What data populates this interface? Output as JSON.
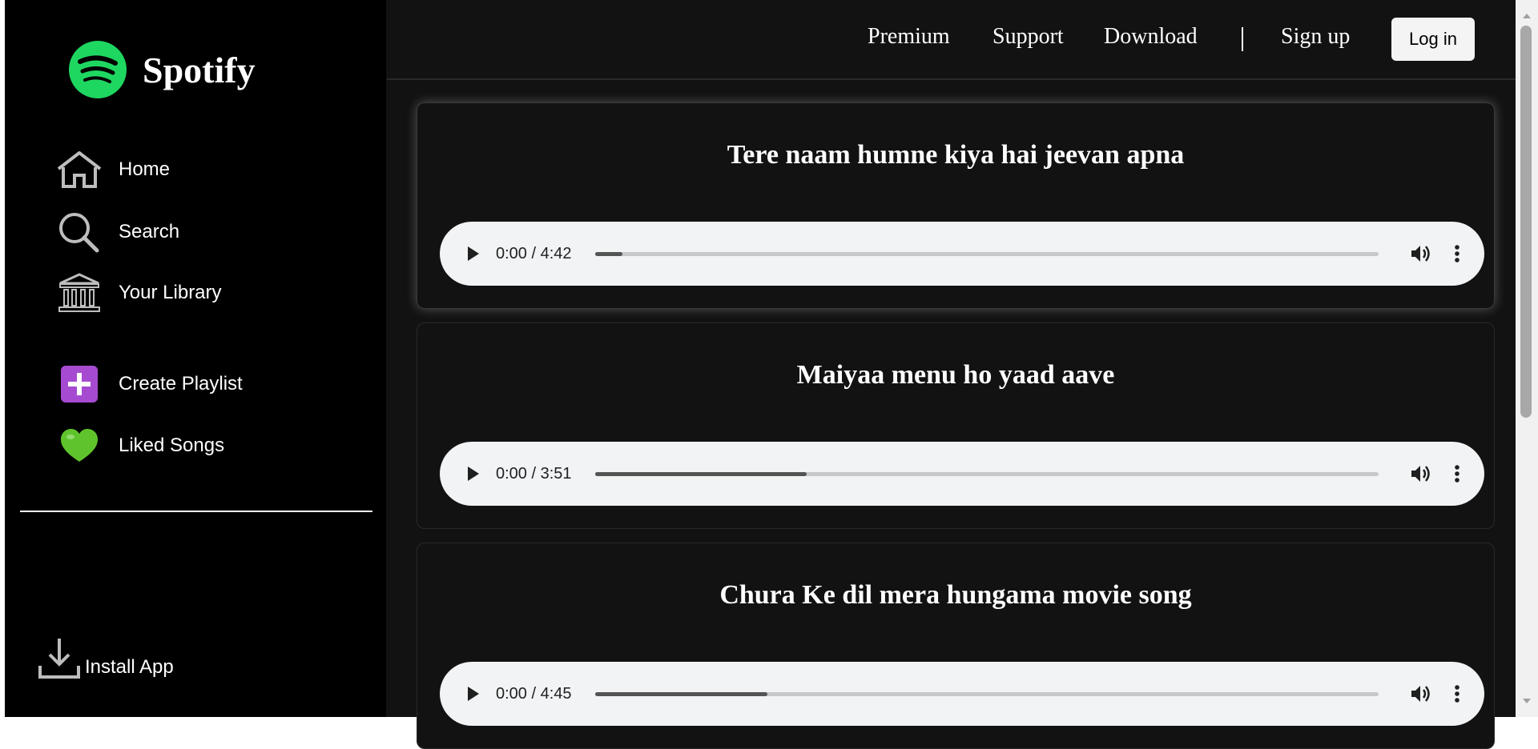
{
  "sidebar": {
    "brand": {
      "name": "Spotify",
      "logo_icon": "spotify-logo-icon",
      "logo_color": "#1ed760"
    },
    "nav": [
      {
        "label": "Home",
        "icon": "home-icon"
      },
      {
        "label": "Search",
        "icon": "search-icon"
      },
      {
        "label": "Your Library",
        "icon": "library-icon"
      }
    ],
    "actions": [
      {
        "label": "Create Playlist",
        "icon": "plus-icon",
        "color": "#a64bd1"
      },
      {
        "label": "Liked Songs",
        "icon": "green-heart-icon",
        "color": "#5fc42c"
      }
    ],
    "install": {
      "label": "Install App",
      "icon": "download-icon"
    }
  },
  "topbar": {
    "links": [
      "Premium",
      "Support",
      "Download"
    ],
    "separator": "|",
    "signup": "Sign up",
    "login": "Log in"
  },
  "songs": [
    {
      "title": "Tere naam humne kiya hai jeevan apna",
      "time": "0:00 / 4:42",
      "buffered": 0.035
    },
    {
      "title": "Maiyaa menu ho yaad aave",
      "time": "0:00 / 3:51",
      "buffered": 0.27
    },
    {
      "title": "Chura Ke dil mera hungama movie song",
      "time": "0:00 / 4:45",
      "buffered": 0.22
    }
  ],
  "colors": {
    "sidebar_bg": "#000000",
    "main_bg": "#121212",
    "player_bg": "#f1f3f4",
    "accent_green": "#1ed760"
  }
}
